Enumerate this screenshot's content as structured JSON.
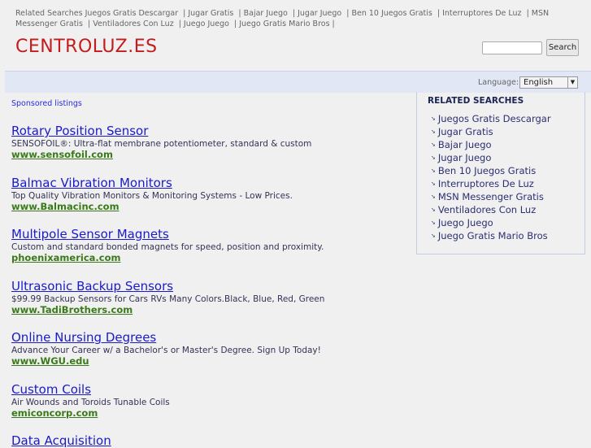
{
  "top_links": {
    "label": "Related Searches",
    "items": [
      "Juegos Gratis Descargar",
      "Jugar Gratis",
      "Bajar Juego",
      "Jugar Juego",
      "Ben 10 Juegos Gratis",
      "Interruptores De Luz",
      "MSN Messenger Gratis",
      "Ventiladores Con Luz",
      "Juego Juego",
      "Juego Gratis Mario Bros"
    ]
  },
  "logo": "CENTROLUZ.ES",
  "search": {
    "value": "",
    "button": "Search"
  },
  "language": {
    "label": "Language:",
    "selected": "English"
  },
  "sponsored_label": "Sponsored listings",
  "listings": [
    {
      "title": "Rotary Position Sensor",
      "desc": "SENSOFOIL®: Ultra-flat membrane potentiometer, standard & custom",
      "url": "www.sensofoil.com"
    },
    {
      "title": "Balmac Vibration Monitors",
      "desc": "Top Quality Vibration Monitors & Monitoring Systems - Low Prices.",
      "url": "www.Balmacinc.com"
    },
    {
      "title": "Multipole Sensor Magnets",
      "desc": "Custom and standard bonded magnets for speed, position and proximity.",
      "url": "phoenixamerica.com"
    },
    {
      "title": "Ultrasonic Backup Sensors",
      "desc": "$99.99 Backup Sensors for Cars RVs Many Colors.Black, Blue, Red, Green",
      "url": "www.TadiBrothers.com"
    },
    {
      "title": "Online Nursing Degrees",
      "desc": "Advance Your Career w/ a Bachelor's or Master's Degree. Sign Up Today!",
      "url": "www.WGU.edu"
    },
    {
      "title": "Custom Coils",
      "desc": "Air Wounds and Toroids Tunable Coils",
      "url": "emiconcorp.com"
    },
    {
      "title": "Data Acquisition",
      "desc": "",
      "url": ""
    }
  ],
  "related": {
    "title": "RELATED SEARCHES",
    "items": [
      "Juegos Gratis Descargar",
      "Jugar Gratis",
      "Bajar Juego",
      "Jugar Juego",
      "Ben 10 Juegos Gratis",
      "Interruptores De Luz",
      "MSN Messenger Gratis",
      "Ventiladores Con Luz",
      "Juego Juego",
      "Juego Gratis Mario Bros"
    ]
  }
}
